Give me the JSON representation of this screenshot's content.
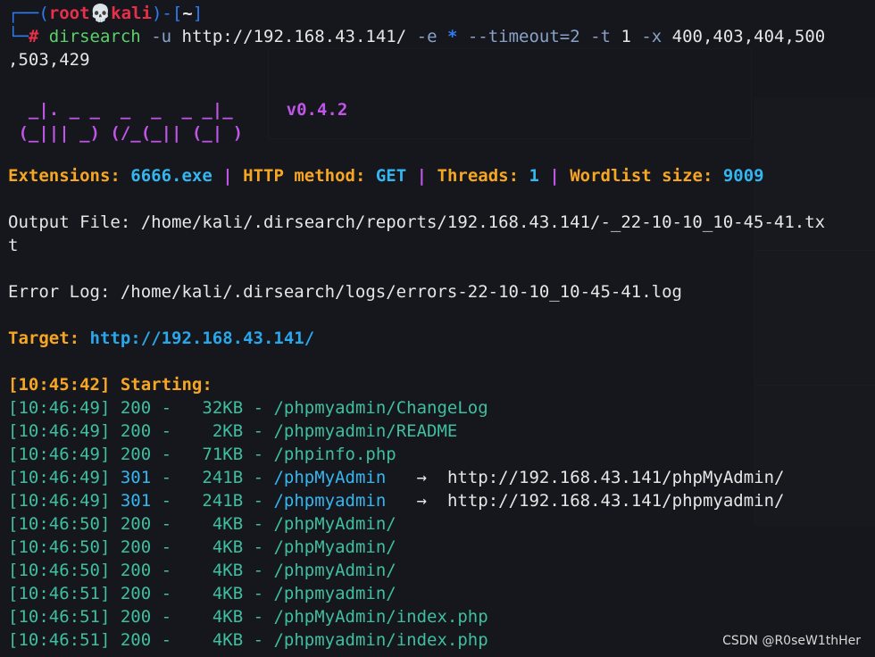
{
  "prompt": {
    "box_top": "┌──(",
    "user": "root💀kali",
    "box_mid": ")-[",
    "cwd": "~",
    "box_end": "]",
    "box_bottom": "└─",
    "hash": "#",
    "command": "dirsearch",
    "args_1": " -u ",
    "url": "http://192.168.43.141/",
    "args_2": " -e ",
    "star": "*",
    "args_3": " --timeout=2 -t ",
    "threads_arg": "1",
    "args_4": " -x ",
    "exclude": "400,403,404,500",
    "wrap": ",503,429"
  },
  "banner": {
    "logo_1": "  _|. _ _  _  _  _ _|_",
    "logo_2": " (_||| _) (/_(_|| (_| )",
    "version": "v0.4.2"
  },
  "summary": {
    "ext_label": "Extensions: ",
    "ext_value": "6666.exe",
    "sep": " | ",
    "method_label": "HTTP method: ",
    "method_value": "GET",
    "threads_label": "Threads: ",
    "threads_value": "1",
    "wordlist_label": "Wordlist size: ",
    "wordlist_value": "9009"
  },
  "output_file": {
    "line1": "Output File: /home/kali/.dirsearch/reports/192.168.43.141/-_22-10-10_10-45-41.tx",
    "line2": "t"
  },
  "error_log": "Error Log: /home/kali/.dirsearch/logs/errors-22-10-10_10-45-41.log",
  "target": {
    "label": "Target: ",
    "url": "http://192.168.43.141/"
  },
  "starting": {
    "time": "[10:45:42]",
    "label": " Starting:"
  },
  "results": [
    {
      "time": "[10:46:49]",
      "status": "200",
      "size": "  32KB",
      "path": "/phpmyadmin/ChangeLog",
      "redirect": ""
    },
    {
      "time": "[10:46:49]",
      "status": "200",
      "size": "   2KB",
      "path": "/phpmyadmin/README",
      "redirect": ""
    },
    {
      "time": "[10:46:49]",
      "status": "200",
      "size": "  71KB",
      "path": "/phpinfo.php",
      "redirect": ""
    },
    {
      "time": "[10:46:49]",
      "status": "301",
      "size": "  241B",
      "path": "/phpMyAdmin   ",
      "redirect": "http://192.168.43.141/phpMyAdmin/"
    },
    {
      "time": "[10:46:49]",
      "status": "301",
      "size": "  241B",
      "path": "/phpmyadmin   ",
      "redirect": "http://192.168.43.141/phpmyadmin/"
    },
    {
      "time": "[10:46:50]",
      "status": "200",
      "size": "   4KB",
      "path": "/phpMyAdmin/",
      "redirect": ""
    },
    {
      "time": "[10:46:50]",
      "status": "200",
      "size": "   4KB",
      "path": "/phpMyadmin/",
      "redirect": ""
    },
    {
      "time": "[10:46:50]",
      "status": "200",
      "size": "   4KB",
      "path": "/phpmyAdmin/",
      "redirect": ""
    },
    {
      "time": "[10:46:51]",
      "status": "200",
      "size": "   4KB",
      "path": "/phpmyadmin/",
      "redirect": ""
    },
    {
      "time": "[10:46:51]",
      "status": "200",
      "size": "   4KB",
      "path": "/phpMyAdmin/index.php",
      "redirect": ""
    },
    {
      "time": "[10:46:51]",
      "status": "200",
      "size": "   4KB",
      "path": "/phpmyadmin/index.php",
      "redirect": ""
    }
  ],
  "arrow_glyph": "→",
  "watermark": "CSDN @R0seW1thHer",
  "colors": {
    "background": "#1a1d23",
    "prompt_red": "#e8304a",
    "accent_blue": "#2f7df6",
    "warning_yellow": "#f6a623",
    "ok_green": "#3fbf9f",
    "banner_purple": "#c155e8"
  }
}
